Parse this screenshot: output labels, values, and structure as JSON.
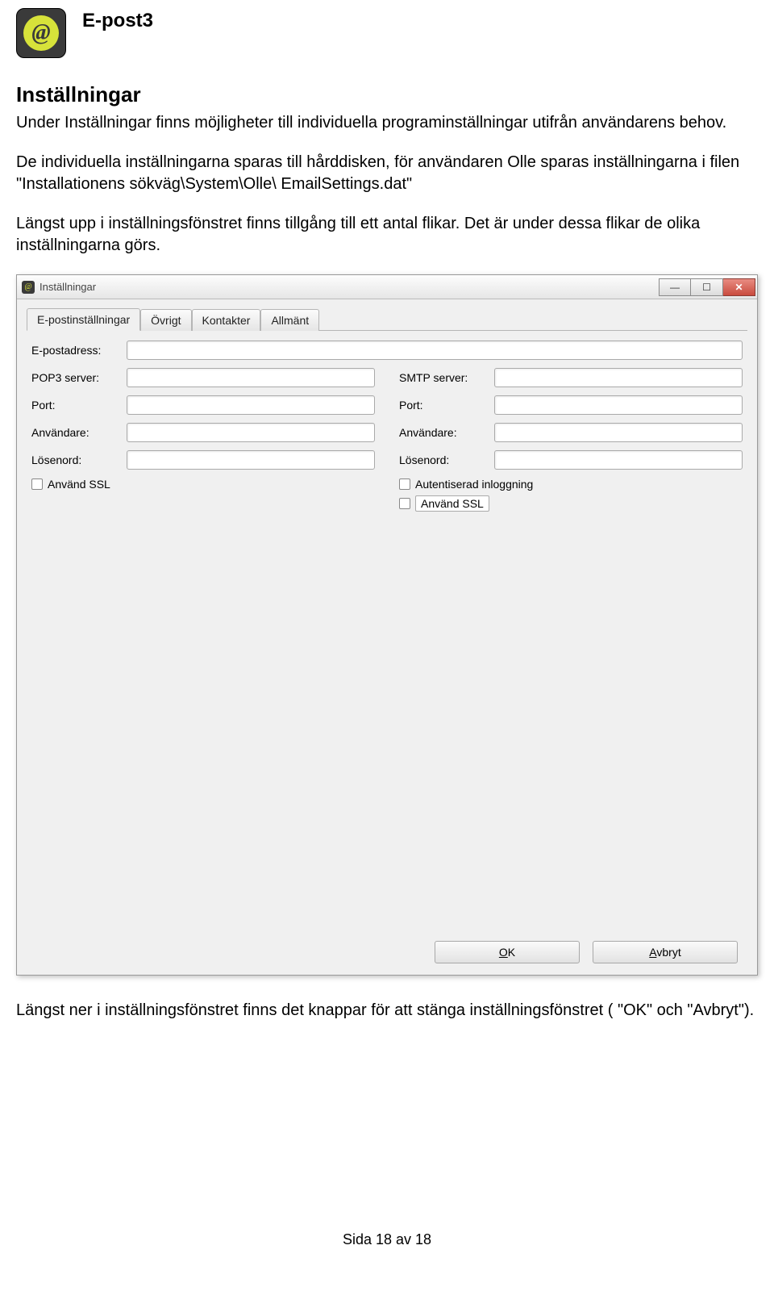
{
  "header": {
    "title": "E-post3",
    "icon_glyph": "@"
  },
  "section": {
    "heading": "Inställningar",
    "para1": "Under Inställningar finns möjligheter till individuella programinställningar utifrån användarens behov.",
    "para2": "De individuella inställningarna sparas till hårddisken, för användaren Olle sparas inställningarna i filen \"Installationens sökväg\\System\\Olle\\ EmailSettings.dat\"",
    "para3": "Längst upp i inställningsfönstret finns tillgång till ett antal flikar. Det är under dessa flikar de olika inställningarna görs.",
    "para4": "Längst ner i inställningsfönstret finns det knappar för att stänga inställningsfönstret ( \"OK\" och \"Avbryt\")."
  },
  "window": {
    "title": "Inställningar",
    "tabs": [
      "E-postinställningar",
      "Övrigt",
      "Kontakter",
      "Allmänt"
    ],
    "email_label": "E-postadress:",
    "left": {
      "pop3": "POP3 server:",
      "port": "Port:",
      "user": "Användare:",
      "pass": "Lösenord:",
      "ssl": "Använd SSL"
    },
    "right": {
      "smtp": "SMTP server:",
      "port": "Port:",
      "user": "Användare:",
      "pass": "Lösenord:",
      "auth": "Autentiserad inloggning",
      "ssl": "Använd SSL"
    },
    "buttons": {
      "ok_pre": "O",
      "ok_u": "K",
      "cancel_pre": "A",
      "cancel_u": "v",
      "cancel_post": "bryt"
    }
  },
  "footer": {
    "page": "Sida 18 av 18"
  }
}
